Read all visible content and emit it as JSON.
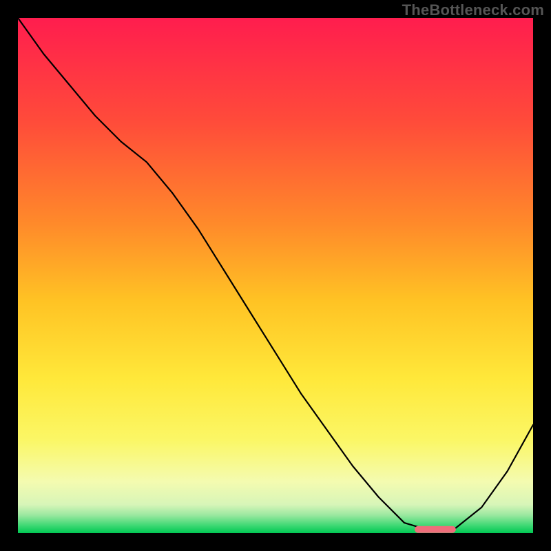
{
  "watermark": "TheBottleneck.com",
  "chart_data": {
    "type": "line",
    "title": "",
    "xlabel": "",
    "ylabel": "",
    "xlim": [
      0,
      100
    ],
    "ylim": [
      0,
      100
    ],
    "x": [
      0,
      5,
      10,
      15,
      20,
      25,
      30,
      35,
      40,
      45,
      50,
      55,
      60,
      65,
      70,
      75,
      80,
      82.5,
      85,
      90,
      95,
      100
    ],
    "values": [
      100,
      93,
      87,
      81,
      76,
      72,
      66,
      59,
      51,
      43,
      35,
      27,
      20,
      13,
      7,
      2,
      0.5,
      0.3,
      1,
      5,
      12,
      21
    ],
    "marker": {
      "x_start": 77,
      "x_end": 85,
      "y": 0.7,
      "color": "#ef6d7a"
    },
    "gradient_stops": [
      {
        "offset": 0.0,
        "color": "#ff1d4e"
      },
      {
        "offset": 0.2,
        "color": "#ff4b3a"
      },
      {
        "offset": 0.4,
        "color": "#ff8a2a"
      },
      {
        "offset": 0.55,
        "color": "#ffc324"
      },
      {
        "offset": 0.7,
        "color": "#ffe83a"
      },
      {
        "offset": 0.82,
        "color": "#fbf766"
      },
      {
        "offset": 0.9,
        "color": "#f4fbb0"
      },
      {
        "offset": 0.945,
        "color": "#d7f5b8"
      },
      {
        "offset": 0.965,
        "color": "#9be8a0"
      },
      {
        "offset": 0.985,
        "color": "#3fd974"
      },
      {
        "offset": 1.0,
        "color": "#00c853"
      }
    ]
  }
}
